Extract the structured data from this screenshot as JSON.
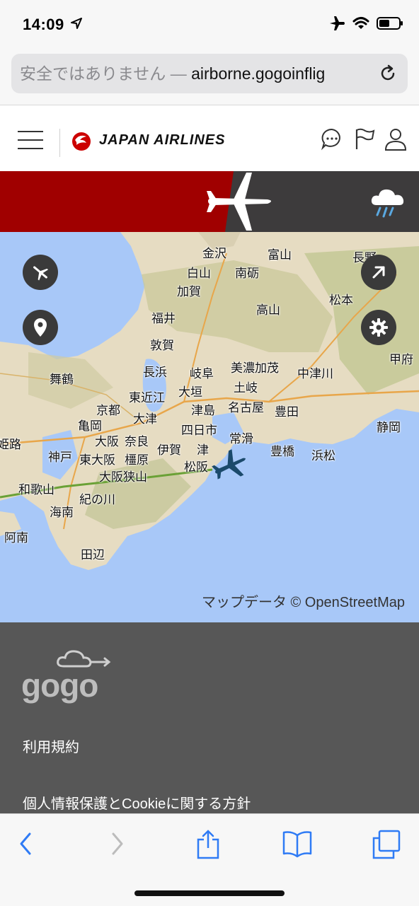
{
  "status_bar": {
    "time": "14:09",
    "icons": [
      "location-arrow-icon",
      "airplane-mode-icon",
      "wifi-icon",
      "battery-icon"
    ]
  },
  "address_bar": {
    "insecure_label": "安全ではありません — ",
    "domain": "airborne.gogoinflig",
    "reload_icon": "reload-icon"
  },
  "header": {
    "brand": "JAPAN AIRLINES",
    "brand_color": "#cc0000",
    "icons": [
      "menu-icon",
      "chat-icon",
      "flag-icon",
      "user-icon"
    ]
  },
  "banner": {
    "colors": {
      "red": "#a00000",
      "dark": "#3d3b3c"
    },
    "icons": [
      "airplane-icon",
      "rain-cloud-icon"
    ]
  },
  "map": {
    "background": "#a8c8f8",
    "labels": [
      {
        "text": "金沢",
        "id": "kanazawa"
      },
      {
        "text": "富山",
        "id": "toyama"
      },
      {
        "text": "長野",
        "id": "nagano"
      },
      {
        "text": "白山",
        "id": "hakusan"
      },
      {
        "text": "南砺",
        "id": "nanto"
      },
      {
        "text": "加賀",
        "id": "kaga"
      },
      {
        "text": "松本",
        "id": "matsumoto"
      },
      {
        "text": "高山",
        "id": "takayama"
      },
      {
        "text": "福井",
        "id": "fukui"
      },
      {
        "text": "敦賀",
        "id": "tsuruga"
      },
      {
        "text": "甲府",
        "id": "kofu"
      },
      {
        "text": "長浜",
        "id": "nagahama"
      },
      {
        "text": "岐阜",
        "id": "gifu"
      },
      {
        "text": "美濃加茂",
        "id": "minokamo"
      },
      {
        "text": "中津川",
        "id": "nakatsugawa"
      },
      {
        "text": "舞鶴",
        "id": "maizuru"
      },
      {
        "text": "東近江",
        "id": "higashiomi"
      },
      {
        "text": "大垣",
        "id": "ogaki"
      },
      {
        "text": "土岐",
        "id": "toki"
      },
      {
        "text": "京都",
        "id": "kyoto"
      },
      {
        "text": "大津",
        "id": "otsu"
      },
      {
        "text": "津島",
        "id": "tsushima"
      },
      {
        "text": "名古屋",
        "id": "nagoya"
      },
      {
        "text": "豊田",
        "id": "toyota"
      },
      {
        "text": "亀岡",
        "id": "kameoka"
      },
      {
        "text": "四日市",
        "id": "yokkaichi"
      },
      {
        "text": "静岡",
        "id": "shizuoka"
      },
      {
        "text": "姫路",
        "id": "himeji"
      },
      {
        "text": "大阪",
        "id": "osaka"
      },
      {
        "text": "奈良",
        "id": "nara"
      },
      {
        "text": "伊賀",
        "id": "iga"
      },
      {
        "text": "常滑",
        "id": "tokoname"
      },
      {
        "text": "豊橋",
        "id": "toyohashi"
      },
      {
        "text": "浜松",
        "id": "hamamatsu"
      },
      {
        "text": "神戸",
        "id": "kobe"
      },
      {
        "text": "東大阪",
        "id": "higashiosaka"
      },
      {
        "text": "橿原",
        "id": "kashihara"
      },
      {
        "text": "津",
        "id": "tsu"
      },
      {
        "text": "松阪",
        "id": "matsusaka"
      },
      {
        "text": "大阪狭山",
        "id": "osakasayama"
      },
      {
        "text": "和歌山",
        "id": "wakayama"
      },
      {
        "text": "紀の川",
        "id": "kinokawa"
      },
      {
        "text": "海南",
        "id": "kainan"
      },
      {
        "text": "阿南",
        "id": "anan"
      },
      {
        "text": "田辺",
        "id": "tanabe"
      }
    ],
    "attribution": "マップデータ © OpenStreetMap",
    "buttons": [
      "airport-icon",
      "location-pin-icon",
      "expand-arrow-icon",
      "settings-gear-icon"
    ]
  },
  "footer": {
    "brand": "gogo",
    "links": [
      "利用規約",
      "個人情報保護とCookieに関する方針"
    ]
  },
  "toolbar": {
    "icons": [
      "back-icon",
      "forward-icon",
      "share-icon",
      "bookmarks-icon",
      "tabs-icon"
    ]
  }
}
